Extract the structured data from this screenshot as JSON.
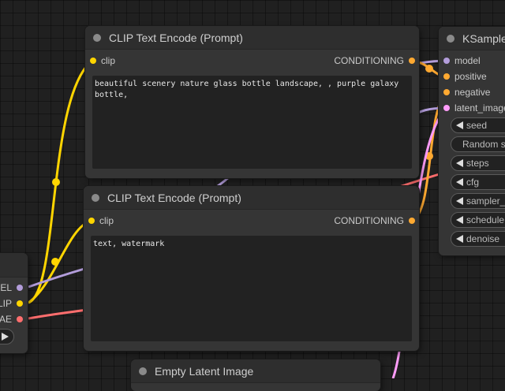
{
  "clip_text_encode_positive": {
    "title": "CLIP Text Encode (Prompt)",
    "input_label": "clip",
    "output_label": "CONDITIONING",
    "text": "beautiful scenery nature glass bottle landscape, , purple galaxy bottle,"
  },
  "clip_text_encode_negative": {
    "title": "CLIP Text Encode (Prompt)",
    "input_label": "clip",
    "output_label": "CONDITIONING",
    "text": "text, watermark"
  },
  "ksampler": {
    "title": "KSample",
    "inputs": [
      "model",
      "positive",
      "negative",
      "latent_image"
    ],
    "widgets": {
      "seed": "seed",
      "control_after_generate": "Random s",
      "steps": "steps",
      "cfg": "cfg",
      "sampler": "sampler_",
      "scheduler": "schedule",
      "denoise": "denoise"
    }
  },
  "checkpoint_loader": {
    "outputs": [
      "EL",
      "LIP",
      "AE"
    ]
  },
  "empty_latent": {
    "title": "Empty Latent Image"
  },
  "colors": {
    "model": "#b39ddb",
    "clip": "#ffd500",
    "vae": "#ff6e6e",
    "conditioning": "#ffa931",
    "latent": "#ff9cf9",
    "background": "#202020",
    "node": "#353535"
  }
}
